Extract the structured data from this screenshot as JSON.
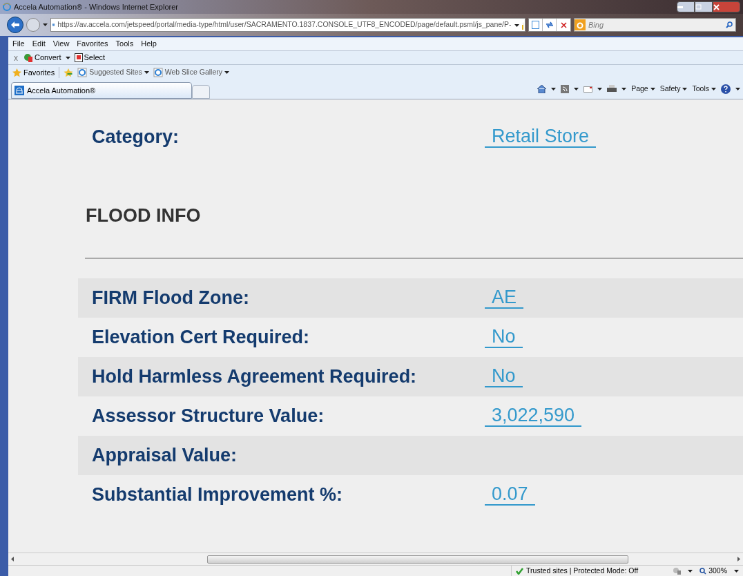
{
  "window": {
    "title": "Accela Automation® - Windows Internet Explorer"
  },
  "address_bar": {
    "url": "https://av.accela.com/jetspeed/portal/media-type/html/user/SACRAMENTO.1837.CONSOLE_UTF8_ENCODED/page/default.psml/js_pane/P-"
  },
  "search": {
    "placeholder": "Bing"
  },
  "menu": [
    "File",
    "Edit",
    "View",
    "Favorites",
    "Tools",
    "Help"
  ],
  "convert_bar": {
    "close": "x",
    "convert": "Convert",
    "select": "Select"
  },
  "favorites_bar": {
    "favorites": "Favorites",
    "links": [
      "Suggested Sites",
      "Web Slice Gallery"
    ]
  },
  "tabs": [
    {
      "label": "Accela Automation®",
      "selected": true
    },
    {
      "selected": false
    }
  ],
  "command_bar": [
    "Page",
    "Safety",
    "Tools"
  ],
  "category": {
    "label": "Category:",
    "value": "Retail Store"
  },
  "section_title": "FLOOD INFO",
  "fields": [
    {
      "label": "FIRM Flood Zone:",
      "value": "AE"
    },
    {
      "label": "Elevation Cert Required:",
      "value": "No"
    },
    {
      "label": "Hold Harmless Agreement Required:",
      "value": "No"
    },
    {
      "label": "Assessor Structure Value:",
      "value": "3,022,590"
    },
    {
      "label": "Appraisal Value:"
    },
    {
      "label": "Substantial Improvement %:",
      "value": "0.07"
    }
  ],
  "status_bar": {
    "zone": "Trusted sites | Protected Mode: Off",
    "zoom": "300%"
  }
}
